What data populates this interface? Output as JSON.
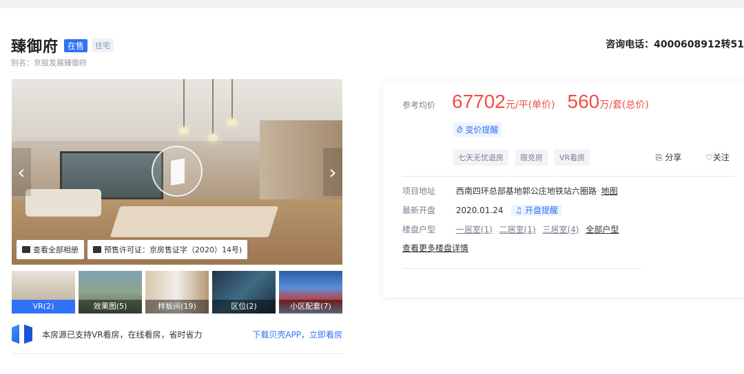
{
  "header": {
    "title": "臻御府",
    "sale_tag": "在售",
    "type_tag": "住宅",
    "alias": "别名：京投发展臻御府",
    "phone": "咨询电话：4000608912转51"
  },
  "gallery": {
    "prev_arrow": "‹",
    "next_arrow": "›",
    "view_all_label": "查看全部相册",
    "permit_label": "预售许可证：京房售证字（2020）14号)"
  },
  "thumbs": [
    {
      "label": "VR(2)"
    },
    {
      "label": "效果图(5)"
    },
    {
      "label": "样板间(19)"
    },
    {
      "label": "区位(2)"
    },
    {
      "label": "小区配套(7)"
    }
  ],
  "vr_promo": {
    "text": "本房源已支持VR看房，在线看房，省时省力",
    "link": "下载贝壳APP，立即看房"
  },
  "price": {
    "label": "参考均价",
    "unit_price": "67702",
    "unit_price_suffix": "元/平(单价)",
    "total_price": "560",
    "total_price_suffix": "万/套(总价)",
    "alert_label": "⦳ 变价提醒"
  },
  "features": [
    "七天无忧退房",
    "限竞房",
    "VR看房"
  ],
  "actions": {
    "share": "分享",
    "follow": "关注"
  },
  "info": {
    "address_label": "项目地址",
    "address_value": "西南四环总部基地郭公庄地铁站六圈路",
    "map_link": "地图",
    "open_label": "最新开盘",
    "open_value": "2020.01.24",
    "open_remind": "开盘提醒",
    "layout_label": "楼盘户型",
    "layouts": [
      "一居室(1)",
      "二居室(1)",
      "三居室(4)"
    ],
    "all_layouts": "全部户型",
    "more_link": "查看更多楼盘详情"
  }
}
